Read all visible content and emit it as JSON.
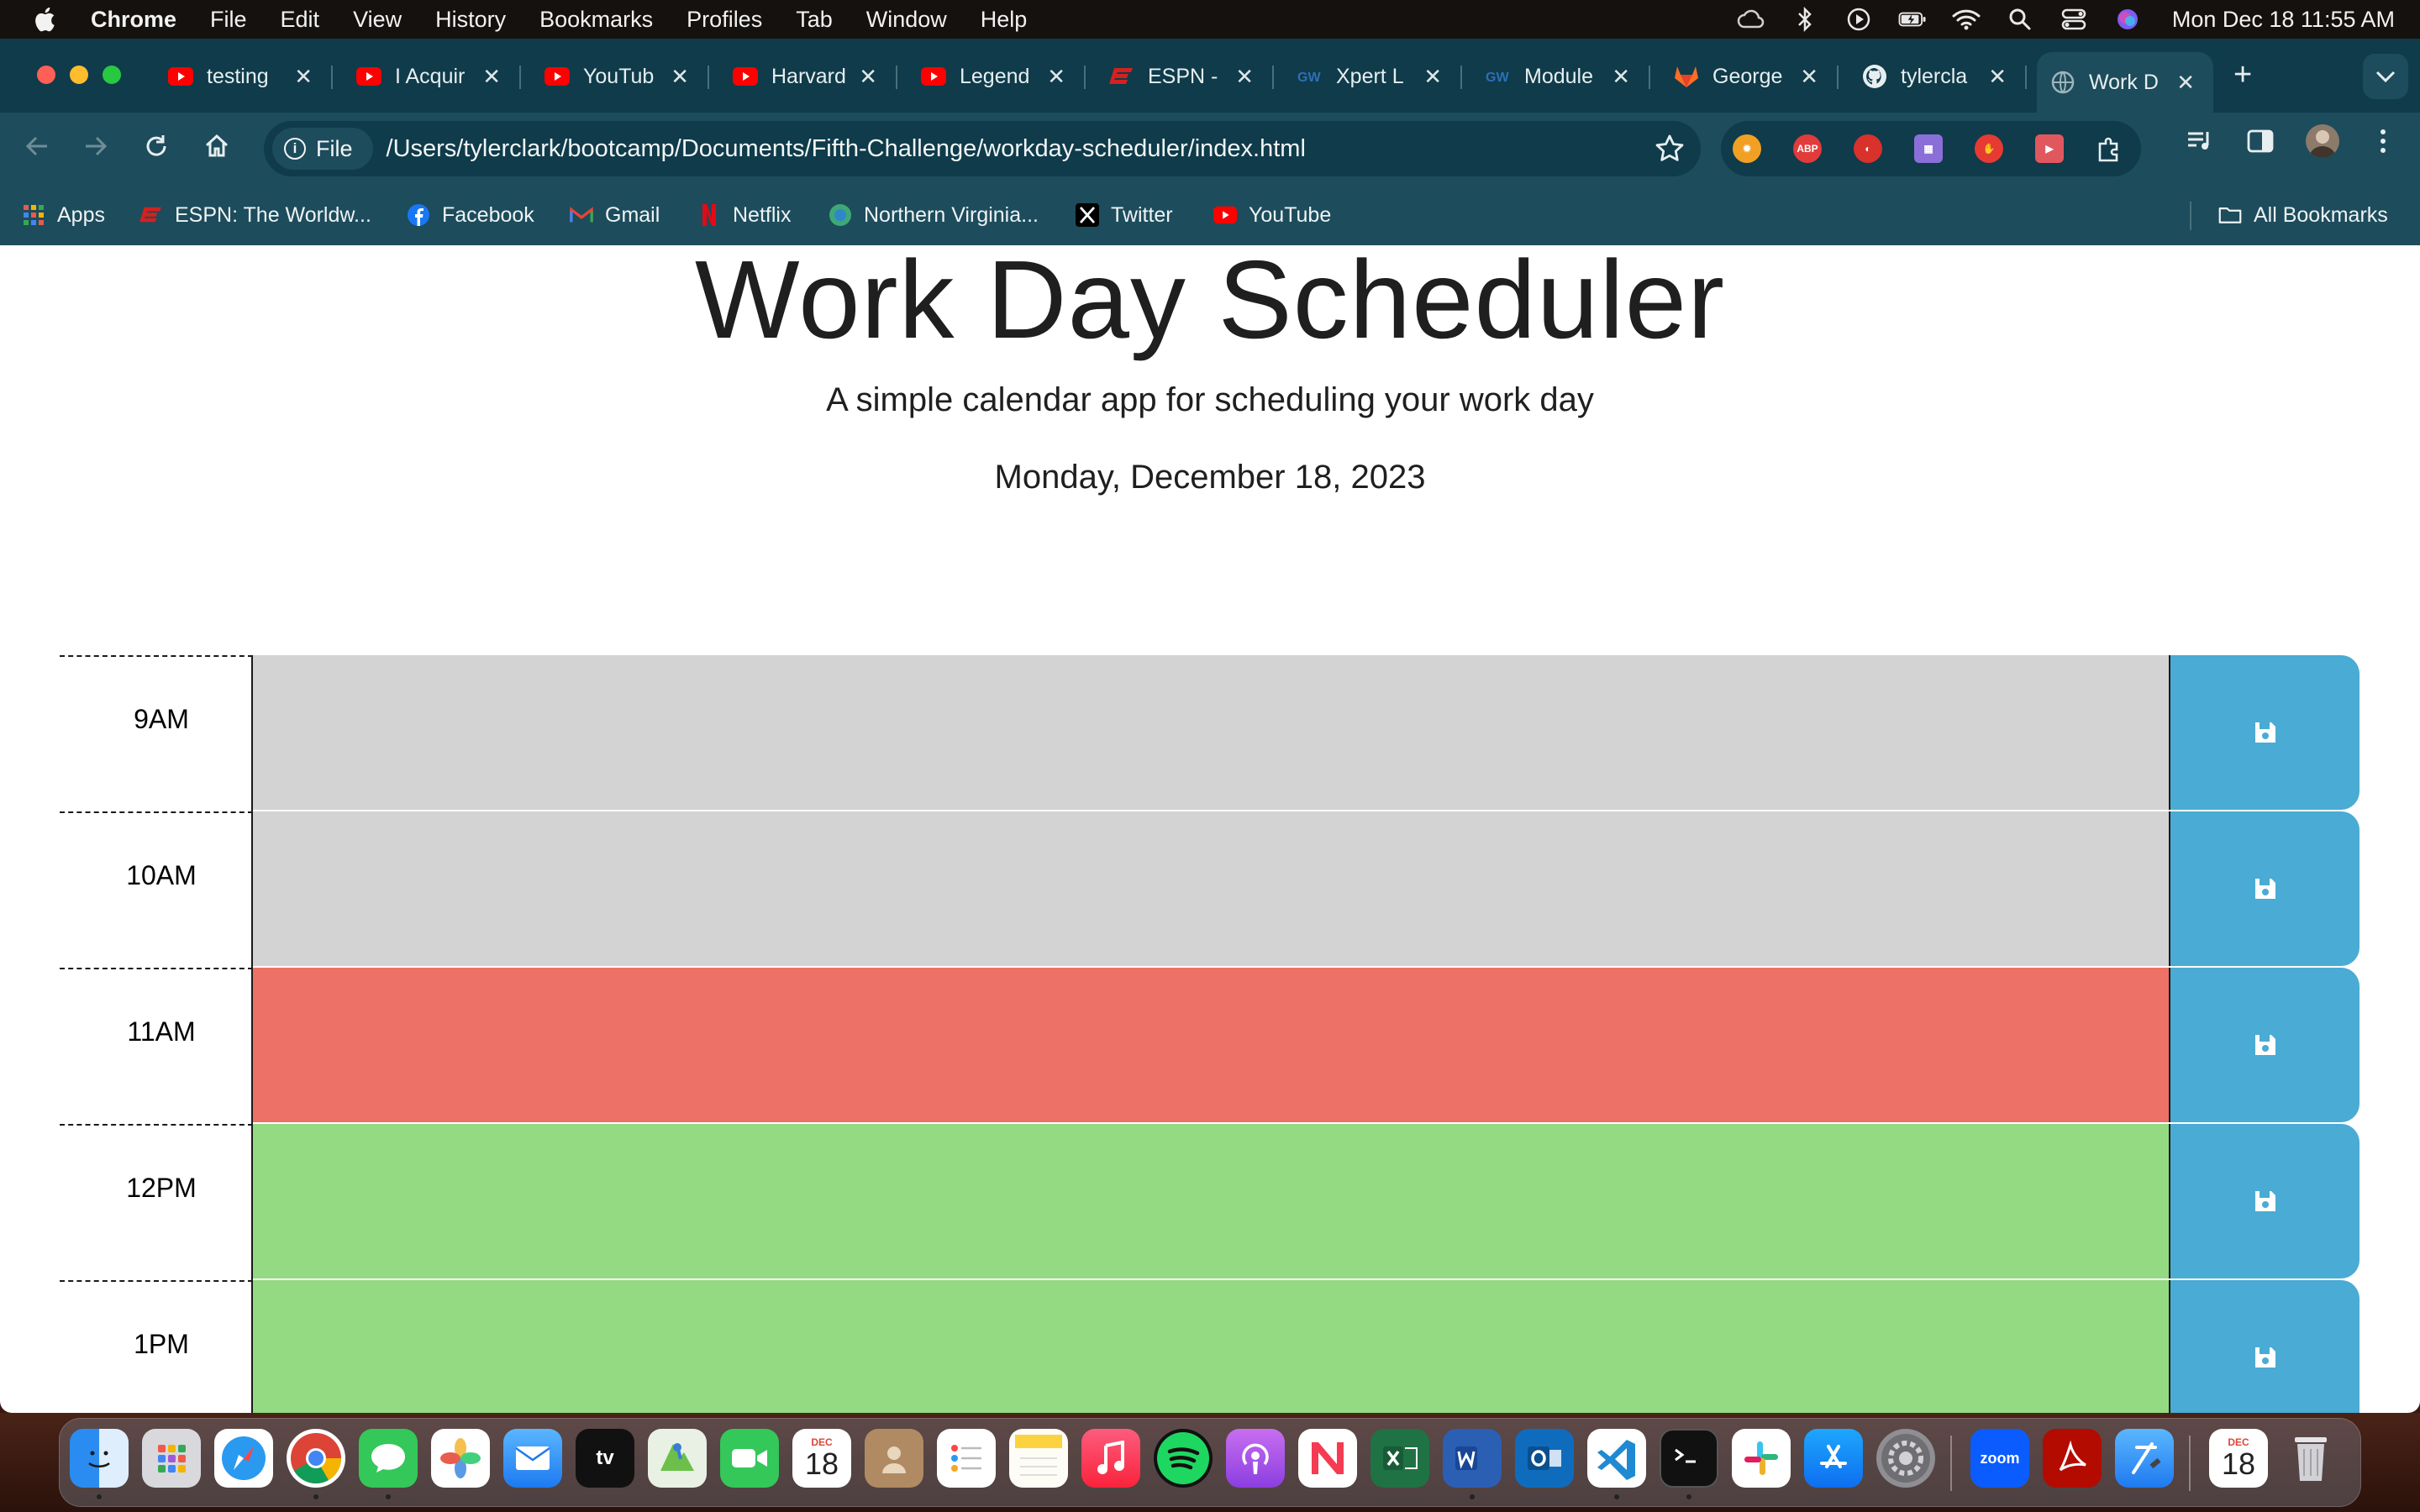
{
  "menubar": {
    "app_name": "Chrome",
    "menus": [
      "File",
      "Edit",
      "View",
      "History",
      "Bookmarks",
      "Profiles",
      "Tab",
      "Window",
      "Help"
    ],
    "clock": "Mon Dec 18  11:55 AM"
  },
  "browser": {
    "tabs": [
      {
        "title": "testing",
        "icon": "youtube-icon"
      },
      {
        "title": "I Acquir",
        "icon": "youtube-icon"
      },
      {
        "title": "YouTub",
        "icon": "youtube-icon"
      },
      {
        "title": "Harvard",
        "icon": "youtube-icon"
      },
      {
        "title": "Legend",
        "icon": "youtube-icon"
      },
      {
        "title": "ESPN -",
        "icon": "espn-icon"
      },
      {
        "title": "Xpert L",
        "icon": "gw-icon"
      },
      {
        "title": "Module",
        "icon": "gw-icon"
      },
      {
        "title": "George",
        "icon": "gitlab-icon"
      },
      {
        "title": "tylercla",
        "icon": "github-icon"
      },
      {
        "title": "Work D",
        "icon": "globe-icon",
        "active": true
      }
    ],
    "site_chip_label": "File",
    "url": "/Users/tylerclark/bootcamp/Documents/Fifth-Challenge/workday-scheduler/index.html",
    "bookmarks": [
      {
        "label": "Apps",
        "icon": "apps-grid-icon"
      },
      {
        "label": "ESPN: The Worldw...",
        "icon": "espn-icon"
      },
      {
        "label": "Facebook",
        "icon": "facebook-icon"
      },
      {
        "label": "Gmail",
        "icon": "gmail-icon"
      },
      {
        "label": "Netflix",
        "icon": "netflix-icon"
      },
      {
        "label": "Northern Virginia...",
        "icon": "nova-icon"
      },
      {
        "label": "Twitter",
        "icon": "x-twitter-icon"
      },
      {
        "label": "YouTube",
        "icon": "youtube-icon"
      }
    ],
    "all_bookmarks_label": "All Bookmarks",
    "extension_labels": {
      "abp": "ABP"
    }
  },
  "page": {
    "title": "Work Day Scheduler",
    "lead": "A simple calendar app for scheduling your work day",
    "current_day": "Monday, December 18, 2023",
    "rows": [
      {
        "hour": "9AM",
        "status": "past",
        "text": ""
      },
      {
        "hour": "10AM",
        "status": "past",
        "text": ""
      },
      {
        "hour": "11AM",
        "status": "present",
        "text": ""
      },
      {
        "hour": "12PM",
        "status": "future",
        "text": ""
      },
      {
        "hour": "1PM",
        "status": "future",
        "text": ""
      }
    ],
    "colors": {
      "past": "#d3d3d3",
      "present": "#ee7168",
      "future": "#93da82",
      "save": "#4aabd4"
    }
  },
  "dock": {
    "calendar_month": "DEC",
    "calendar_day": "18",
    "zoom_label": "zoom"
  }
}
